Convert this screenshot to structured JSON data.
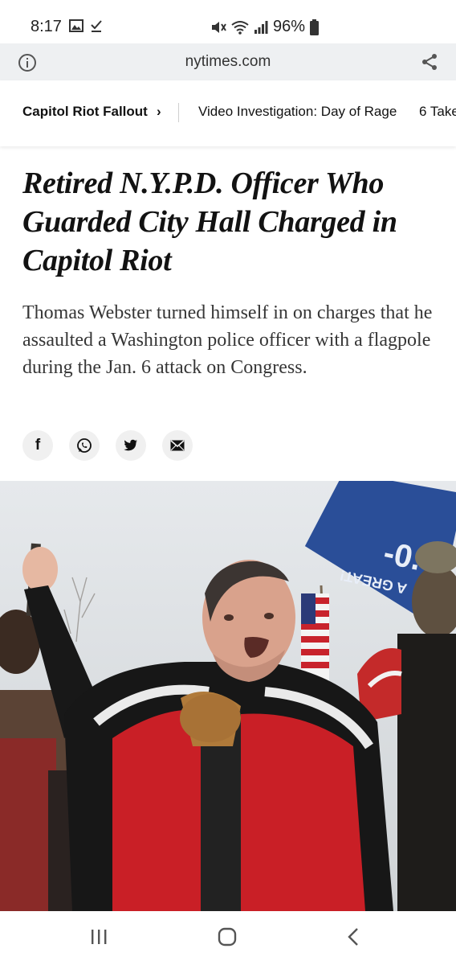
{
  "status_bar": {
    "time": "8:17",
    "battery": "96%",
    "icons": [
      "gallery-icon",
      "download-done-icon",
      "mute-icon",
      "wifi-icon",
      "signal-icon",
      "battery-icon"
    ]
  },
  "url_bar": {
    "url": "nytimes.com",
    "icons": [
      "info-icon",
      "share-icon"
    ]
  },
  "section_nav": {
    "section": "Capitol Riot Fallout",
    "chevron": "›",
    "links": [
      "Video Investigation: Day of Rage",
      "6 Take"
    ]
  },
  "article": {
    "headline": "Retired N.Y.P.D. Officer Who Guarded City Hall Charged in Capitol Riot",
    "summary": "Thomas Webster turned himself in on charges that he assaulted a Washington police officer with a flagpole during the Jan. 6 attack on Congress.",
    "share": {
      "facebook": "f",
      "icons": [
        "facebook-icon",
        "whatsapp-icon",
        "twitter-icon",
        "email-icon"
      ]
    }
  },
  "photo": {
    "banner_text": "A GREAT!",
    "banner_big": "-0."
  },
  "android_nav": {
    "icons": [
      "recents-icon",
      "home-icon",
      "back-icon"
    ]
  }
}
